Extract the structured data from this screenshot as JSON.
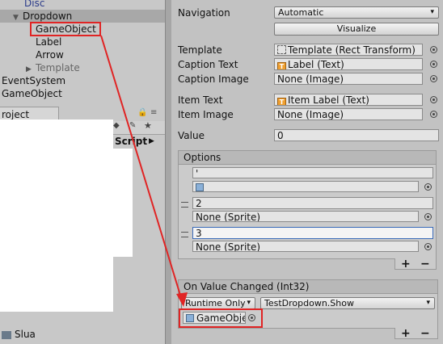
{
  "hierarchy": {
    "items": [
      {
        "label": "Disc"
      },
      {
        "label": "Dropdown",
        "arrow": "▼"
      },
      {
        "label": "GameObject"
      },
      {
        "label": "Label"
      },
      {
        "label": "Arrow"
      },
      {
        "label": "Template",
        "arrow": "▶"
      },
      {
        "label": "EventSystem"
      },
      {
        "label": "GameObject"
      }
    ]
  },
  "project": {
    "tab_label": "roject",
    "script_label": "Script",
    "bottom_item": "Slua"
  },
  "inspector": {
    "navigation": {
      "label": "Navigation",
      "value": "Automatic"
    },
    "visualize_button": "Visualize",
    "template": {
      "label": "Template",
      "value": "Template (Rect Transform)"
    },
    "caption_text": {
      "label": "Caption Text",
      "value": "Label (Text)"
    },
    "caption_image": {
      "label": "Caption Image",
      "value": "None (Image)"
    },
    "item_text": {
      "label": "Item Text",
      "value": "Item Label (Text)"
    },
    "item_image": {
      "label": "Item Image",
      "value": "None (Image)"
    },
    "value": {
      "label": "Value",
      "value": "0"
    },
    "options": {
      "title": "Options",
      "items": [
        {
          "text": "'",
          "sprite": ""
        },
        {
          "text": "2",
          "sprite": "None (Sprite)"
        },
        {
          "text": "3",
          "sprite": "None (Sprite)"
        }
      ],
      "add": "+",
      "remove": "−"
    },
    "on_value_changed": {
      "title": "On Value Changed (Int32)",
      "runtime": "Runtime Only",
      "function": "TestDropdown.Show",
      "object": "GameObje",
      "add": "+",
      "remove": "−"
    }
  },
  "colors": {
    "highlight": "#e02424",
    "selected_row": "#a8a8a8"
  }
}
